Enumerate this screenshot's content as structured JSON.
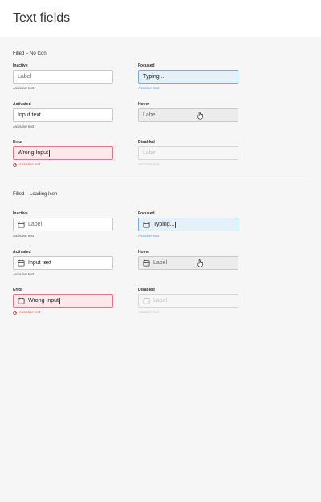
{
  "header": {
    "title": "Text fields"
  },
  "sections": [
    {
      "title": "Filled – No Icon",
      "fields": {
        "inactive": {
          "state_label": "Inactive",
          "value": "Label",
          "helper": "Assistive text"
        },
        "focused": {
          "state_label": "Focused",
          "value": "Typing...",
          "helper": "Assistive text"
        },
        "activated": {
          "state_label": "Activated",
          "value": "Input text",
          "helper": "Assistive text"
        },
        "hover": {
          "state_label": "Hover",
          "value": "Label",
          "helper": ""
        },
        "error": {
          "state_label": "Error",
          "value": "Wrong Input",
          "helper": "Assistive text"
        },
        "disabled": {
          "state_label": "Disabled",
          "value": "Label",
          "helper": "Assistive text"
        }
      }
    },
    {
      "title": "Filled – Leading Icon",
      "fields": {
        "inactive": {
          "state_label": "Inactive",
          "value": "Label",
          "helper": "Assistive text"
        },
        "focused": {
          "state_label": "Focused",
          "value": "Typing...",
          "helper": "Assistive text"
        },
        "activated": {
          "state_label": "Activated",
          "value": "Input text",
          "helper": "Assistive text"
        },
        "hover": {
          "state_label": "Hover",
          "value": "Label",
          "helper": ""
        },
        "error": {
          "state_label": "Error",
          "value": "Wrong Input",
          "helper": "Assistive text"
        },
        "disabled": {
          "state_label": "Disabled",
          "value": "Label",
          "helper": "Assistive text"
        }
      }
    }
  ],
  "icons": {
    "leading": "calendar-icon",
    "error": "error-circle-icon",
    "cursor": "hand-pointer-icon"
  },
  "colors": {
    "focused": "#4a9fd8",
    "error": "#d9534f",
    "hover": "#ececec",
    "disabled": "#c2c2c2"
  }
}
